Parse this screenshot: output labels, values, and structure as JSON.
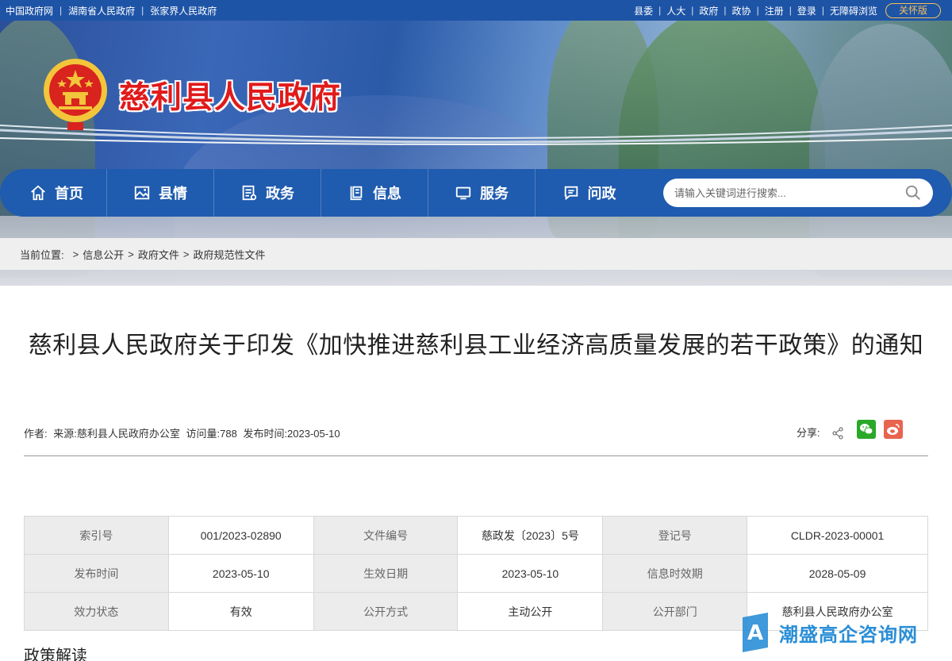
{
  "topbar": {
    "left_links": [
      "中国政府网",
      "湖南省人民政府",
      "张家界人民政府"
    ],
    "right_links": [
      "县委",
      "人大",
      "政府",
      "政协",
      "注册",
      "登录",
      "无障碍浏览"
    ],
    "care_button": "关怀版"
  },
  "header": {
    "site_title": "慈利县人民政府",
    "brand_red": "#e11a1a",
    "nav_blue": "#1f5bae"
  },
  "nav": {
    "items": [
      {
        "label": "首页",
        "icon": "home-icon"
      },
      {
        "label": "县情",
        "icon": "image-icon"
      },
      {
        "label": "政务",
        "icon": "document-icon"
      },
      {
        "label": "信息",
        "icon": "info-list-icon"
      },
      {
        "label": "服务",
        "icon": "monitor-icon"
      },
      {
        "label": "问政",
        "icon": "message-icon"
      }
    ],
    "search_placeholder": "请输入关键词进行搜索..."
  },
  "breadcrumb": {
    "label": "当前位置:",
    "items": [
      "信息公开",
      "政府文件",
      "政府规范性文件"
    ]
  },
  "article": {
    "title": "慈利县人民政府关于印发《加快推进慈利县工业经济高质量发展的若干政策》的通知",
    "meta": {
      "author": "作者:",
      "source": "来源:慈利县人民政府办公室",
      "views": "访问量:788",
      "published": "发布时间:2023-05-10"
    },
    "share_label": "分享:"
  },
  "info_table": {
    "rows": [
      [
        {
          "k": "索引号",
          "v": "001/2023-02890"
        },
        {
          "k": "文件编号",
          "v": "慈政发〔2023〕5号"
        },
        {
          "k": "登记号",
          "v": "CLDR-2023-00001"
        }
      ],
      [
        {
          "k": "发布时间",
          "v": "2023-05-10"
        },
        {
          "k": "生效日期",
          "v": "2023-05-10"
        },
        {
          "k": "信息时效期",
          "v": "2028-05-09"
        }
      ],
      [
        {
          "k": "效力状态",
          "v": "有效"
        },
        {
          "k": "公开方式",
          "v": "主动公开"
        },
        {
          "k": "公开部门",
          "v": "慈利县人民政府办公室"
        }
      ]
    ]
  },
  "section_heading": "政策解读",
  "watermark": "潮盛高企咨询网"
}
